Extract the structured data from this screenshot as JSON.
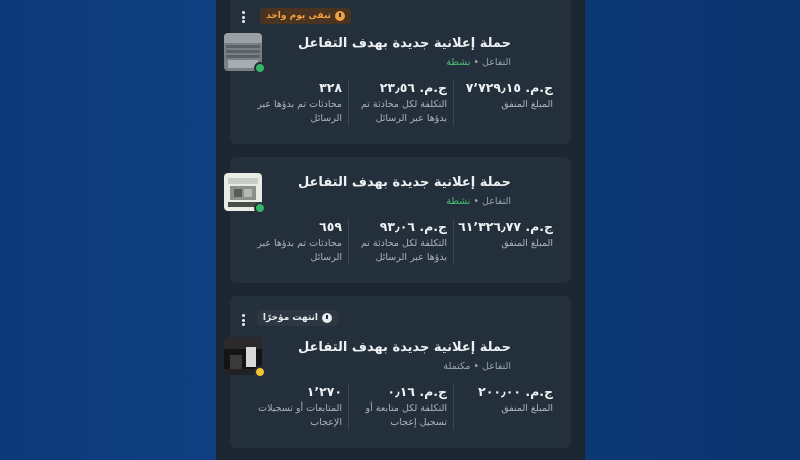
{
  "cards": [
    {
      "badge": "تبقى يوم واحد",
      "title": "حملة إعلانية جديدة بهدف التفاعل",
      "objective": "التفاعل",
      "separator": "•",
      "status": "نشطة",
      "metrics": [
        {
          "value": "ج.م. ٧٬٧٢٩٫١٥",
          "label": "المبلغ المنفق"
        },
        {
          "value": "ج.م. ٢٣٫٥٦",
          "label": "التكلفة لكل محادثة تم بدؤها عبر الرسائل"
        },
        {
          "value": "٣٢٨",
          "label": "محادثات تم بدؤها عبر الرسائل"
        }
      ]
    },
    {
      "title": "حملة إعلانية جديدة بهدف التفاعل",
      "objective": "التفاعل",
      "separator": "•",
      "status": "نشطة",
      "metrics": [
        {
          "value": "ج.م. ٦١٬٣٢٦٫٧٧",
          "label": "المبلغ المنفق"
        },
        {
          "value": "ج.م. ٩٣٫٠٦",
          "label": "التكلفة لكل محادثة تم بدؤها عبر الرسائل"
        },
        {
          "value": "٦٥٩",
          "label": "محادثات تم بدؤها عبر الرسائل"
        }
      ]
    },
    {
      "badge": "انتهت مؤخرًا",
      "title": "حملة إعلانية جديدة بهدف التفاعل",
      "objective": "التفاعل",
      "separator": "•",
      "status": "مكتملة",
      "metrics": [
        {
          "value": "ج.م. ٢٠٠٫٠٠",
          "label": "المبلغ المنفق"
        },
        {
          "value": "ج.م. ٠٫١٦",
          "label": "التكلفة لكل متابعة أو تسجيل إعجاب"
        },
        {
          "value": "١٬٢٧٠",
          "label": "المتابعات أو تسجيلات الإعجاب"
        }
      ]
    }
  ],
  "colors": {
    "active": "#35b56a",
    "completed": "#f2c230",
    "warning": "#f0a040"
  }
}
